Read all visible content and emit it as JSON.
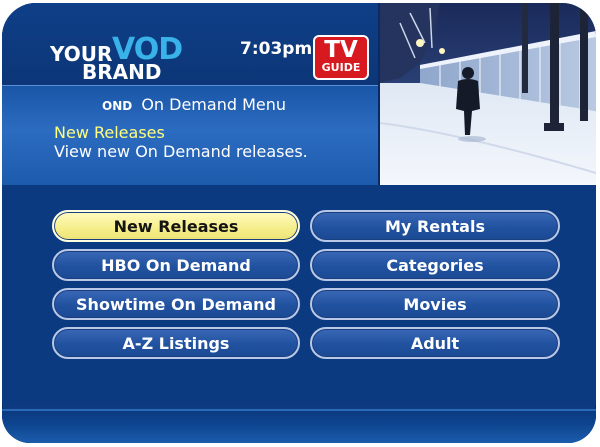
{
  "brand": {
    "your": "YOUR",
    "vod": "VOD",
    "brand": "BRAND"
  },
  "clock": "7:03pm",
  "tv_guide": {
    "line1": "TV",
    "line2": "GUIDE"
  },
  "header": {
    "ond_icon": "OND",
    "title": "On Demand Menu"
  },
  "selection": {
    "title": "New Releases",
    "description": "View new On Demand releases."
  },
  "menu": {
    "left": [
      {
        "label": "New Releases",
        "selected": true
      },
      {
        "label": "HBO On Demand",
        "selected": false
      },
      {
        "label": "Showtime On Demand",
        "selected": false
      },
      {
        "label": "A-Z Listings",
        "selected": false
      }
    ],
    "right": [
      {
        "label": "My Rentals",
        "selected": false
      },
      {
        "label": "Categories",
        "selected": false
      },
      {
        "label": "Movies",
        "selected": false
      },
      {
        "label": "Adult",
        "selected": false
      }
    ]
  },
  "colors": {
    "background": "#0b3a80",
    "selected_button": "#f6ee8a",
    "selected_text": "#ffff80",
    "tv_guide_red": "#d71920",
    "vod_accent": "#39b2ea"
  }
}
